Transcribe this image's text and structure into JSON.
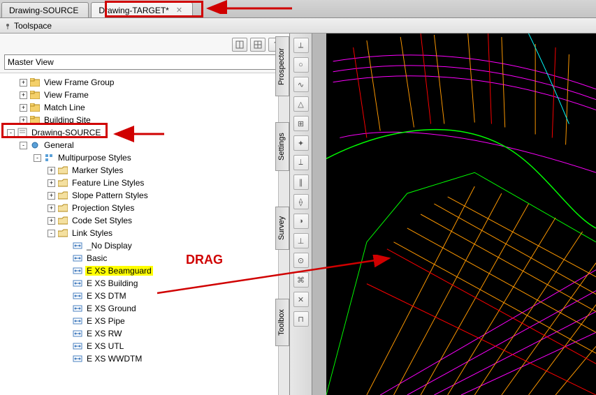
{
  "tabs": {
    "items": [
      {
        "label": "Drawing-SOURCE",
        "active": false,
        "closable": false
      },
      {
        "label": "Drawing-TARGET*",
        "active": true,
        "closable": true
      }
    ]
  },
  "toolspace": {
    "title": "Toolspace"
  },
  "dropdown": {
    "selected": "Master View"
  },
  "panel_buttons": {
    "b1_name": "layout-icon",
    "b2_name": "grid-icon",
    "b3_label": "?",
    "b3_name": "help-icon"
  },
  "vertical_tabs": {
    "prospector": "Prospector",
    "settings": "Settings",
    "survey": "Survey",
    "toolbox": "Toolbox"
  },
  "tree": {
    "nodes": [
      {
        "indent": 2,
        "pm": "+",
        "icon": "folder-icon",
        "label": "View Frame Group"
      },
      {
        "indent": 2,
        "pm": "+",
        "icon": "folder-icon",
        "label": "View Frame"
      },
      {
        "indent": 2,
        "pm": "+",
        "icon": "folder-icon",
        "label": "Match Line"
      },
      {
        "indent": 2,
        "pm": "+",
        "icon": "folder-icon",
        "label": "Building Site"
      },
      {
        "indent": 1,
        "pm": "-",
        "icon": "drawing-icon",
        "label": "Drawing-SOURCE",
        "highlighted": true
      },
      {
        "indent": 2,
        "pm": "-",
        "icon": "gear-icon",
        "label": "General"
      },
      {
        "indent": 3,
        "pm": "-",
        "icon": "styles-icon",
        "label": "Multipurpose Styles"
      },
      {
        "indent": 4,
        "pm": "+",
        "icon": "folder-open-icon",
        "label": "Marker Styles"
      },
      {
        "indent": 4,
        "pm": "+",
        "icon": "folder-open-icon",
        "label": "Feature Line Styles"
      },
      {
        "indent": 4,
        "pm": "+",
        "icon": "folder-open-icon",
        "label": "Slope Pattern Styles"
      },
      {
        "indent": 4,
        "pm": "+",
        "icon": "folder-open-icon",
        "label": "Projection Styles"
      },
      {
        "indent": 4,
        "pm": "+",
        "icon": "folder-open-icon",
        "label": "Code Set Styles"
      },
      {
        "indent": 4,
        "pm": "-",
        "icon": "folder-open-icon",
        "label": "Link Styles"
      },
      {
        "indent": 5,
        "pm": "",
        "icon": "link-style-icon",
        "label": "_No Display"
      },
      {
        "indent": 5,
        "pm": "",
        "icon": "link-style-icon",
        "label": "Basic"
      },
      {
        "indent": 5,
        "pm": "",
        "icon": "link-style-icon",
        "label": "E XS Beamguard",
        "selected": true
      },
      {
        "indent": 5,
        "pm": "",
        "icon": "link-style-icon",
        "label": "E XS Building"
      },
      {
        "indent": 5,
        "pm": "",
        "icon": "link-style-icon",
        "label": "E XS DTM"
      },
      {
        "indent": 5,
        "pm": "",
        "icon": "link-style-icon",
        "label": "E XS Ground"
      },
      {
        "indent": 5,
        "pm": "",
        "icon": "link-style-icon",
        "label": "E XS Pipe"
      },
      {
        "indent": 5,
        "pm": "",
        "icon": "link-style-icon",
        "label": "E XS RW"
      },
      {
        "indent": 5,
        "pm": "",
        "icon": "link-style-icon",
        "label": "E XS UTL"
      },
      {
        "indent": 5,
        "pm": "",
        "icon": "link-style-icon",
        "label": "E XS WWDTM"
      }
    ]
  },
  "annotations": {
    "drag_label": "DRAG",
    "colors": {
      "highlight": "#d00000",
      "selected_bg": "#ffff00"
    }
  }
}
